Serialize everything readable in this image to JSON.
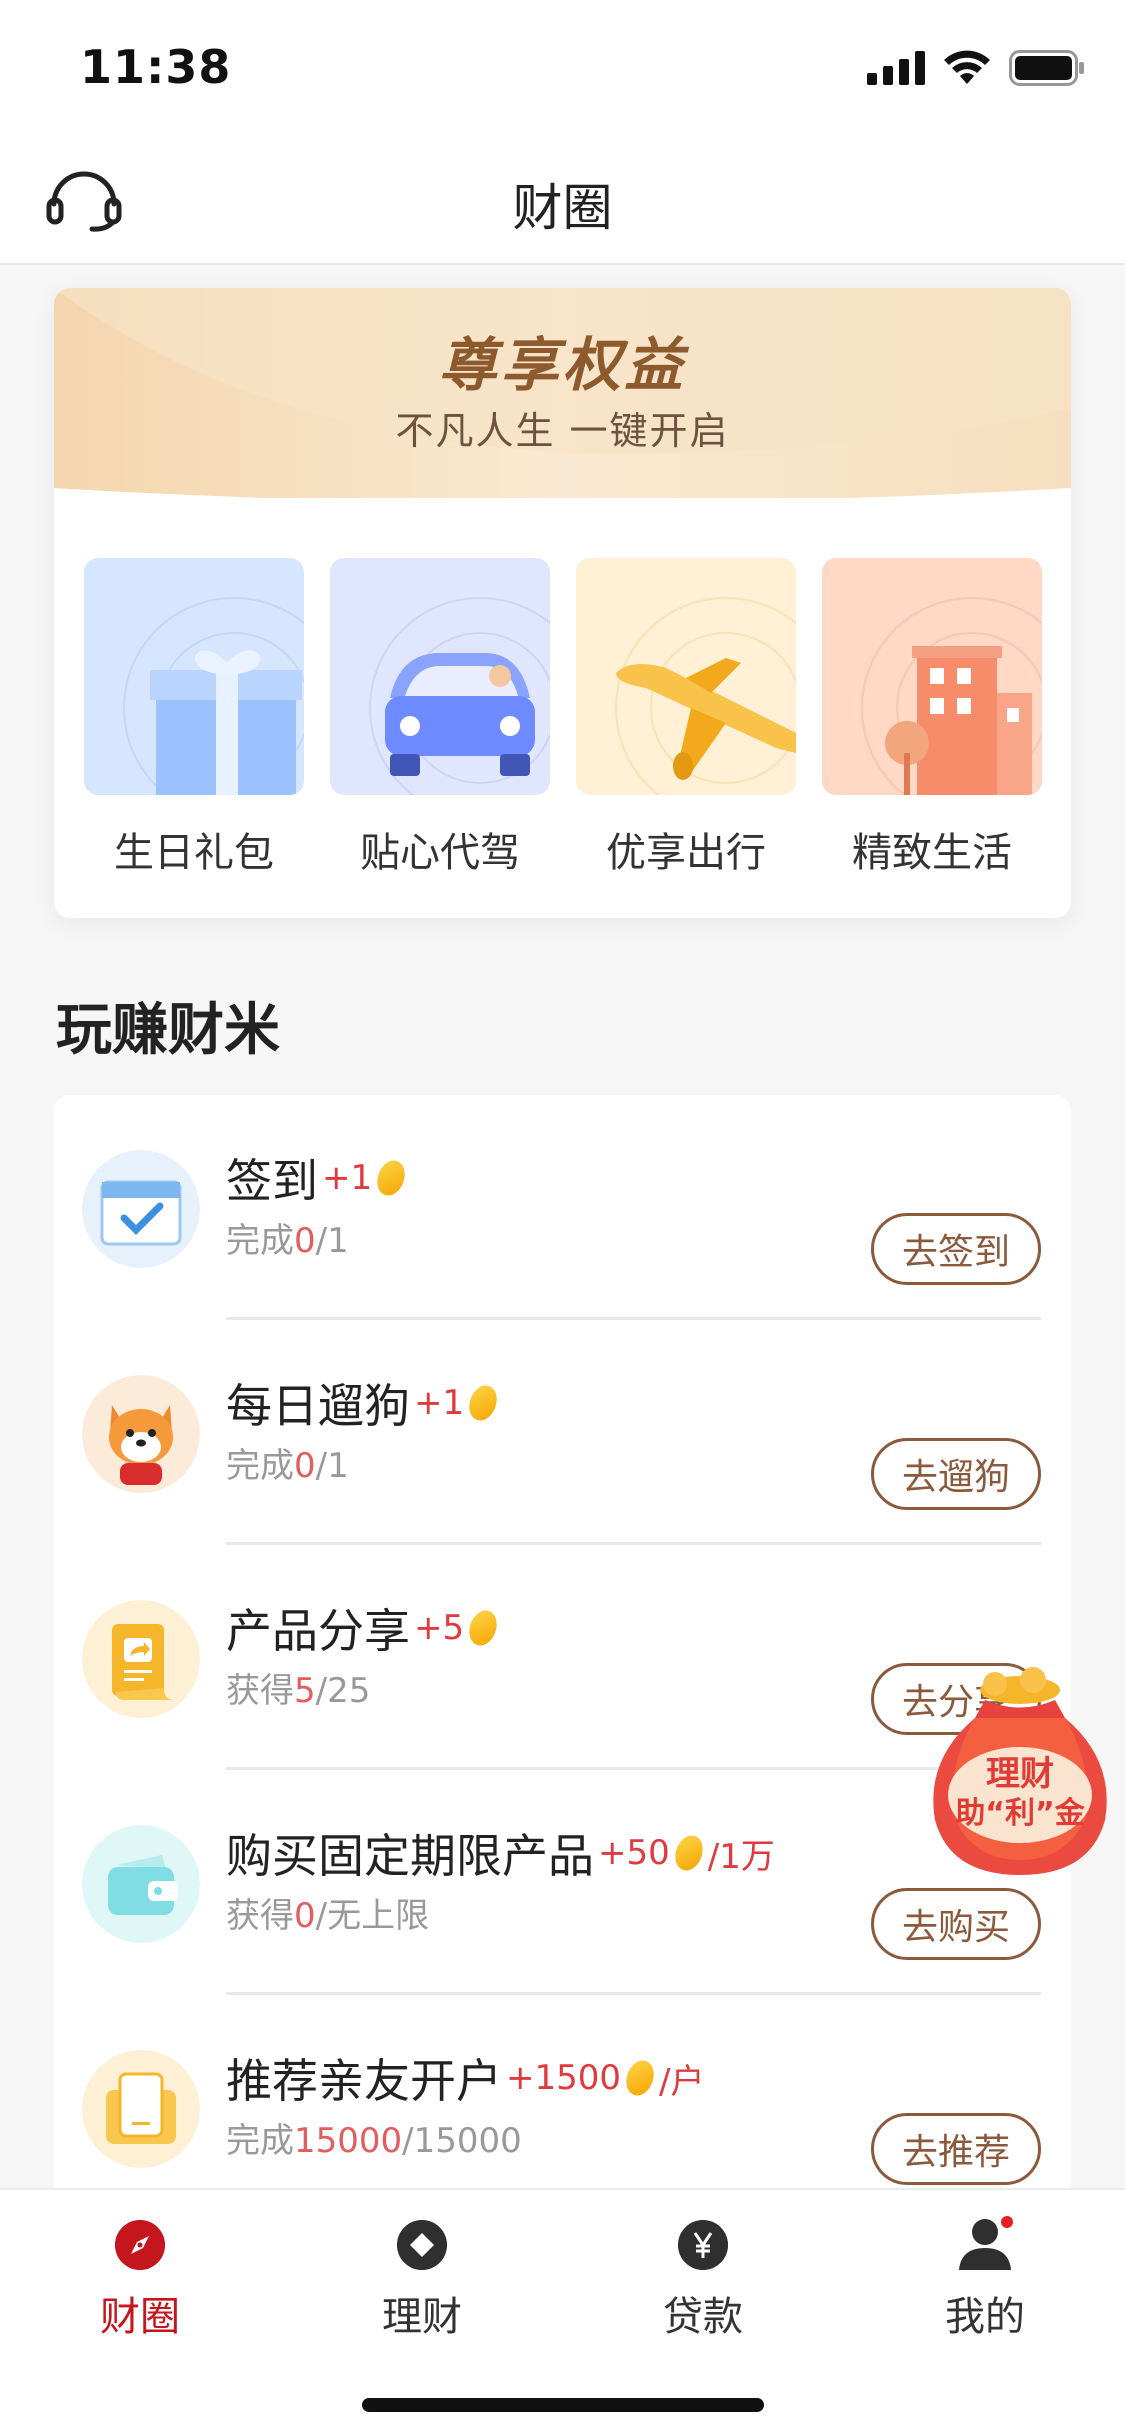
{
  "status_bar": {
    "time": "11:38"
  },
  "nav": {
    "title": "财圈",
    "service_icon": "headset-icon"
  },
  "benefits": {
    "title": "尊享权益",
    "subtitle": "不凡人生 一键开启",
    "items": [
      {
        "label": "生日礼包",
        "icon": "gift-box-icon"
      },
      {
        "label": "贴心代驾",
        "icon": "car-icon"
      },
      {
        "label": "优享出行",
        "icon": "airplane-icon"
      },
      {
        "label": "精致生活",
        "icon": "building-icon"
      }
    ]
  },
  "earn": {
    "section_title": "玩赚财米",
    "tasks": [
      {
        "title": "签到",
        "reward": "+1",
        "unit": "",
        "progress_prefix": "完成",
        "progress_current": "0",
        "progress_total": "/1",
        "button": "去签到"
      },
      {
        "title": "每日遛狗",
        "reward": "+1",
        "unit": "",
        "progress_prefix": "完成",
        "progress_current": "0",
        "progress_total": "/1",
        "button": "去遛狗"
      },
      {
        "title": "产品分享",
        "reward": "+5",
        "unit": "",
        "progress_prefix": "获得",
        "progress_current": "5",
        "progress_total": "/25",
        "button": "去分享"
      },
      {
        "title": "购买固定期限产品",
        "reward": "+50",
        "unit": "/1万",
        "progress_prefix": "获得",
        "progress_current": "0",
        "progress_total": "/无上限",
        "button": "去购买"
      },
      {
        "title": "推荐亲友开户",
        "reward": "+1500",
        "unit": "/户",
        "progress_prefix": "完成",
        "progress_current": "15000",
        "progress_total": "/15000",
        "button": "去推荐"
      }
    ]
  },
  "floating_promo": {
    "text": "理财助“利”金"
  },
  "tabbar": {
    "tabs": [
      {
        "label": "财圈",
        "icon": "compass-icon",
        "active": true
      },
      {
        "label": "理财",
        "icon": "diamond-icon",
        "active": false
      },
      {
        "label": "贷款",
        "icon": "yen-icon",
        "active": false
      },
      {
        "label": "我的",
        "icon": "person-icon",
        "active": false
      }
    ]
  },
  "colors": {
    "accent": "#c4161c",
    "button_border": "#8b5a3c",
    "reward": "#e0393e",
    "gold": "#8d5a2e"
  }
}
